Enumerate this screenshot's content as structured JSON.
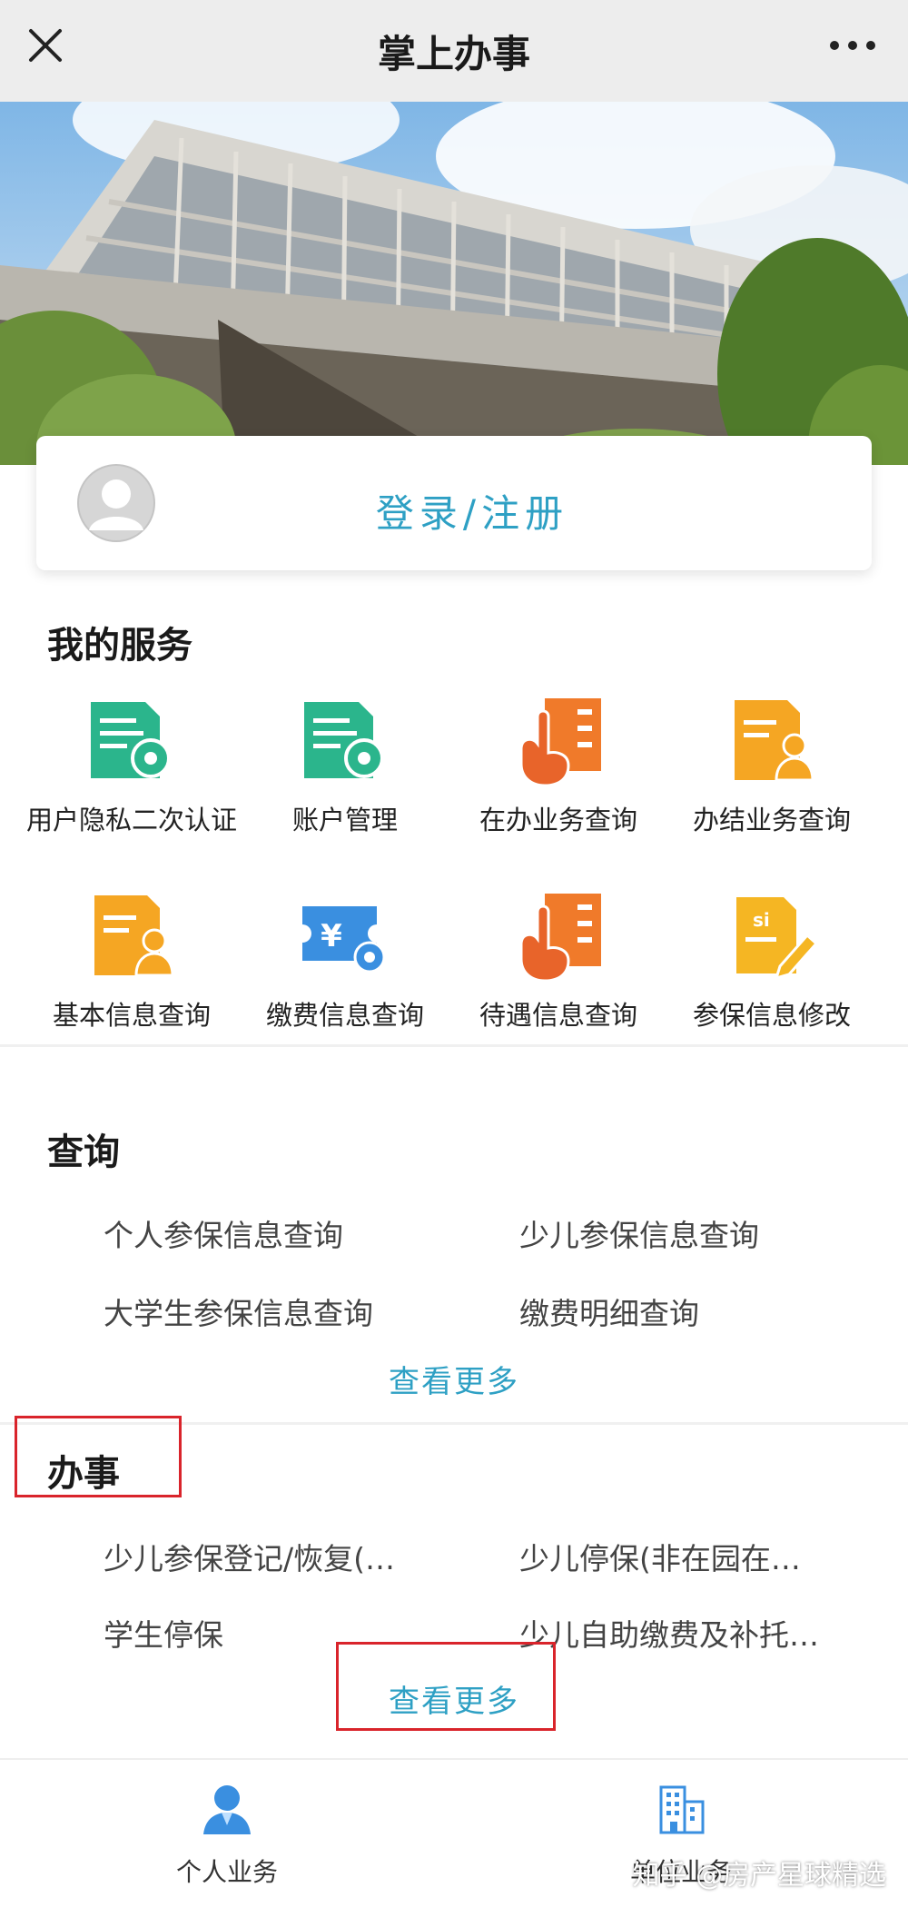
{
  "topbar": {
    "title": "掌上办事"
  },
  "login": {
    "label": "登录/注册"
  },
  "my_services": {
    "title": "我的服务",
    "items": [
      {
        "label": "用户隐私二次认证",
        "icon": "doc-gear-icon"
      },
      {
        "label": "账户管理",
        "icon": "doc-gear-icon"
      },
      {
        "label": "在办业务查询",
        "icon": "hand-checklist-icon"
      },
      {
        "label": "办结业务查询",
        "icon": "doc-person-icon"
      },
      {
        "label": "基本信息查询",
        "icon": "doc-person-icon"
      },
      {
        "label": "缴费信息查询",
        "icon": "ticket-yen-icon"
      },
      {
        "label": "待遇信息查询",
        "icon": "hand-checklist-icon"
      },
      {
        "label": "参保信息修改",
        "icon": "si-doc-edit-icon"
      }
    ]
  },
  "query": {
    "title": "查询",
    "items": [
      "个人参保信息查询",
      "少儿参保信息查询",
      "大学生参保信息查询",
      "缴费明细查询"
    ],
    "more": "查看更多"
  },
  "handle": {
    "title": "办事",
    "items": [
      "少儿参保登记/恢复(…",
      "少儿停保(非在园在…",
      "学生停保",
      "少儿自助缴费及补托…"
    ],
    "more": "查看更多"
  },
  "bottom_nav": [
    {
      "label": "个人业务",
      "icon": "person-icon"
    },
    {
      "label": "单位业务",
      "icon": "building-icon"
    }
  ],
  "watermark": "知乎 @房产星球精选",
  "colors": {
    "accent": "#2ea0c4",
    "green": "#2bb58c",
    "orange": "#f07a2a",
    "yellow": "#f5a623",
    "blue": "#3a8fe0",
    "highlight": "#d9242b"
  }
}
